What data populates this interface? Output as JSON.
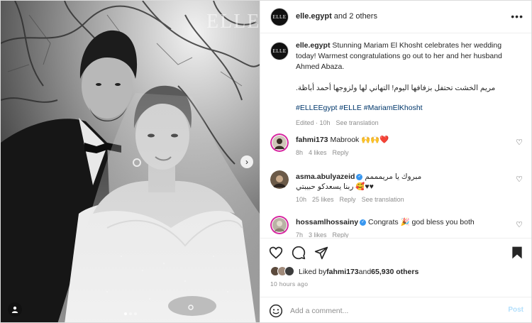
{
  "photo": {
    "watermark": "ELLE"
  },
  "header": {
    "username": "elle.egypt",
    "suffix": " and 2 others",
    "avatar_text": "ELLE"
  },
  "caption": {
    "username": "elle.egypt",
    "text": " Stunning Mariam El Khosht celebrates her wedding today! Warmest congratulations go out to her and her husband Ahmed Abaza.",
    "arabic": "مريم الخشت تحتفل بزفافها اليوم! التهاني لها ولزوجها أحمد أباظة.",
    "hashtags": "#ELLEEgypt #ELLE #MariamElKhosht",
    "edited": "Edited · 10h",
    "see_translation": "See translation"
  },
  "comments": [
    {
      "username": "fahmi173",
      "text": " Mabrook 🙌🙌❤️",
      "time": "8h",
      "likes": "4 likes",
      "reply": "Reply"
    },
    {
      "username": "asma.abulyazeid",
      "text_line1": "مبروك يا مريمممم",
      "text_line2": "ربنا يسعدكو حبيبتي 🥰♥♥",
      "time": "10h",
      "likes": "25 likes",
      "reply": "Reply",
      "see_translation": "See translation"
    },
    {
      "username": "hossamlhossainy",
      "text": " Congrats 🎉 god bless you both",
      "time": "7h",
      "likes": "3 likes",
      "reply": "Reply"
    }
  ],
  "likes": {
    "prefix": "Liked by ",
    "user": "fahmi173",
    "middle": " and ",
    "count": "65,930 others"
  },
  "time_ago": "10 hours ago",
  "add_comment": {
    "placeholder": "Add a comment...",
    "post_label": "Post"
  },
  "colors": {
    "link": "#00376b",
    "muted": "#8e8e8e",
    "post_disabled": "#b2dffc",
    "verified": "#3897f0"
  }
}
